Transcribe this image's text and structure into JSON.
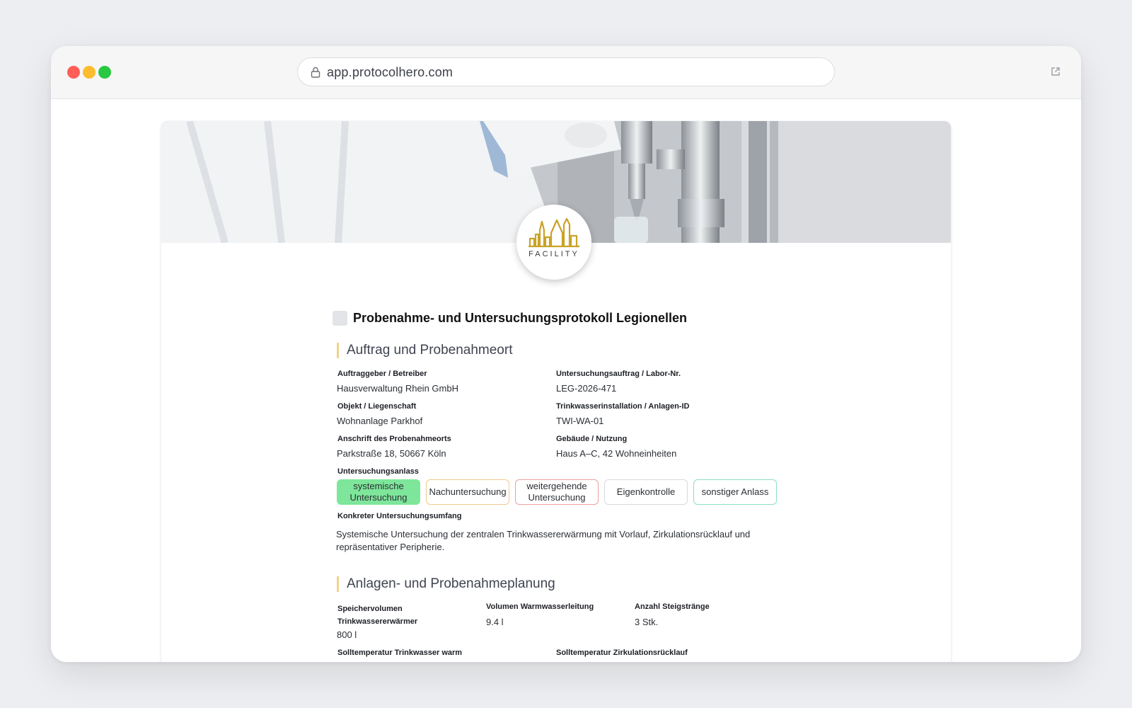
{
  "browser": {
    "url": "app.protocolhero.com"
  },
  "logo": {
    "wordmark": "FACILITY"
  },
  "document": {
    "title": "Probenahme- und Untersuchungsprotokoll Legionellen"
  },
  "section1": {
    "title": "Auftrag und Probenahmeort",
    "fields": {
      "client_label": "Auftraggeber / Betreiber",
      "client_value": "Hausverwaltung Rhein GmbH",
      "order_label": "Untersuchungsauftrag / Labor-Nr.",
      "order_value": "LEG-2026-471",
      "object_label": "Objekt / Liegenschaft",
      "object_value": "Wohnanlage Parkhof",
      "install_label": "Trinkwasserinstallation / Anlagen-ID",
      "install_value": "TWI-WA-01",
      "address_label": "Anschrift des Probenahmeorts",
      "address_value": "Parkstraße 18, 50667 Köln",
      "building_label": "Gebäude / Nutzung",
      "building_value": "Haus A–C, 42 Wohneinheiten"
    },
    "reason_label": "Untersuchungsanlass",
    "reasons": [
      {
        "label": "systemische Untersuchung",
        "selected": true
      },
      {
        "label": "Nachuntersuchung",
        "selected": false
      },
      {
        "label": "weitergehende Untersuchung",
        "selected": false
      },
      {
        "label": "Eigenkontrolle",
        "selected": false
      },
      {
        "label": "sonstiger Anlass",
        "selected": false
      }
    ],
    "scope_label": "Konkreter Untersuchungsumfang",
    "scope_value": "Systemische Untersuchung der zentralen Trinkwassererwärmung mit Vorlauf, Zirkulationsrücklauf und repräsentativer Peripherie."
  },
  "section2": {
    "title": "Anlagen- und Probenahmeplanung",
    "fields": {
      "storage_label": "Speichervolumen Trinkwassererwärmer",
      "storage_value": "800 l",
      "pipe_label": "Volumen Warmwasserleitung",
      "pipe_value": "9.4 l",
      "risers_label": "Anzahl Steigstränge",
      "risers_value": "3 Stk.",
      "temp_warm_label": "Solltemperatur Trinkwasser warm",
      "temp_circ_label": "Solltemperatur Zirkulationsrücklauf"
    }
  },
  "colors": {
    "accent_bar": "#f0d38a",
    "chip_selected": "#7ee69a",
    "logo_gold": "#c9a227"
  }
}
